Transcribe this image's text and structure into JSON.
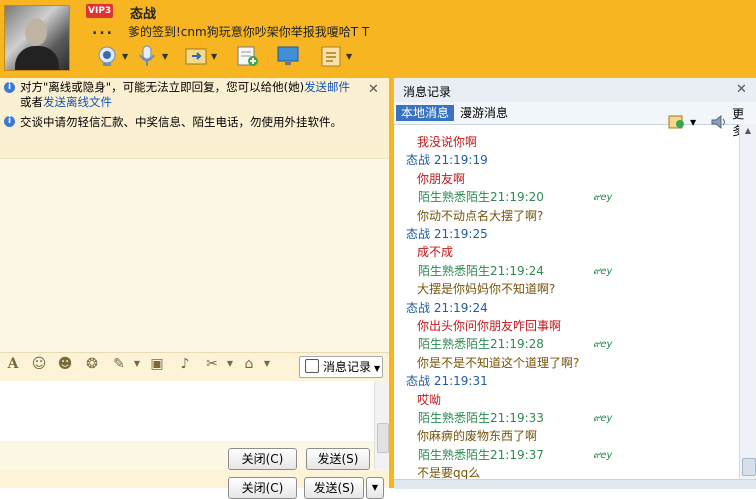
{
  "header": {
    "vip_label": "VIP3",
    "nickname": "态战",
    "dots": "...",
    "signature": "爹的签到!cnm狗玩意你吵架你举报我嗄哈T T",
    "toolbar_icons": [
      "webcam-icon",
      "microphone-icon",
      "file-transfer-icon",
      "add-contact-icon",
      "remote-desktop-icon",
      "apps-icon"
    ]
  },
  "notices": {
    "line1_a": "对方\"离线或隐身\"，可能无法立即回复，您可以给他(她)",
    "link1": "发送邮件",
    "line1_b": "或者",
    "link2": "发送离线文件",
    "line2": "交谈中请勿轻信汇款、中奖信息、陌生电话，勿使用外挂软件。"
  },
  "input_toolbar": {
    "icons": [
      "font-icon",
      "emoji-icon",
      "magic-face-icon",
      "shake-icon",
      "graffiti-icon",
      "image-icon",
      "music-icon",
      "screenshot-icon",
      "tools-icon"
    ],
    "history_label": "消息记录"
  },
  "buttons": {
    "close": "关闭(C)",
    "send": "发送(S)"
  },
  "history": {
    "title": "消息记录",
    "tab_local": "本地消息",
    "tab_roam": "漫游消息",
    "more": "更多",
    "messages": [
      {
        "kind": "text",
        "style": "red",
        "text": "我没说你啊"
      },
      {
        "kind": "sender",
        "style": "me",
        "text": "态战  21:19:19"
      },
      {
        "kind": "text",
        "style": "red",
        "text": "你朋友啊"
      },
      {
        "kind": "sender",
        "style": "other",
        "text": "陌生熟悉陌生21:19:20"
      },
      {
        "kind": "text",
        "style": "olive",
        "text": "你动不动点名大摆了啊?"
      },
      {
        "kind": "sender",
        "style": "me",
        "text": "态战  21:19:25"
      },
      {
        "kind": "text",
        "style": "red",
        "text": "成不成"
      },
      {
        "kind": "sender",
        "style": "other",
        "text": "陌生熟悉陌生21:19:24"
      },
      {
        "kind": "text",
        "style": "olive",
        "text": "大摆是你妈妈你不知道啊?"
      },
      {
        "kind": "sender",
        "style": "me",
        "text": "态战  21:19:24"
      },
      {
        "kind": "text",
        "style": "red",
        "text": "你出头你问你朋友咋回事啊"
      },
      {
        "kind": "sender",
        "style": "other",
        "text": "陌生熟悉陌生21:19:28"
      },
      {
        "kind": "text",
        "style": "olive",
        "text": "你是不是不知道这个道理了啊?"
      },
      {
        "kind": "sender",
        "style": "me",
        "text": "态战  21:19:31"
      },
      {
        "kind": "text",
        "style": "red",
        "text": "哎呦"
      },
      {
        "kind": "sender",
        "style": "other",
        "text": "陌生熟悉陌生21:19:33"
      },
      {
        "kind": "text",
        "style": "olive",
        "text": "你麻痹的废物东西了啊"
      },
      {
        "kind": "sender",
        "style": "other",
        "text": "陌生熟悉陌生21:19:37"
      },
      {
        "kind": "text",
        "style": "olive",
        "text": "不是要qq么"
      }
    ],
    "signature_mark": "๙ey"
  }
}
